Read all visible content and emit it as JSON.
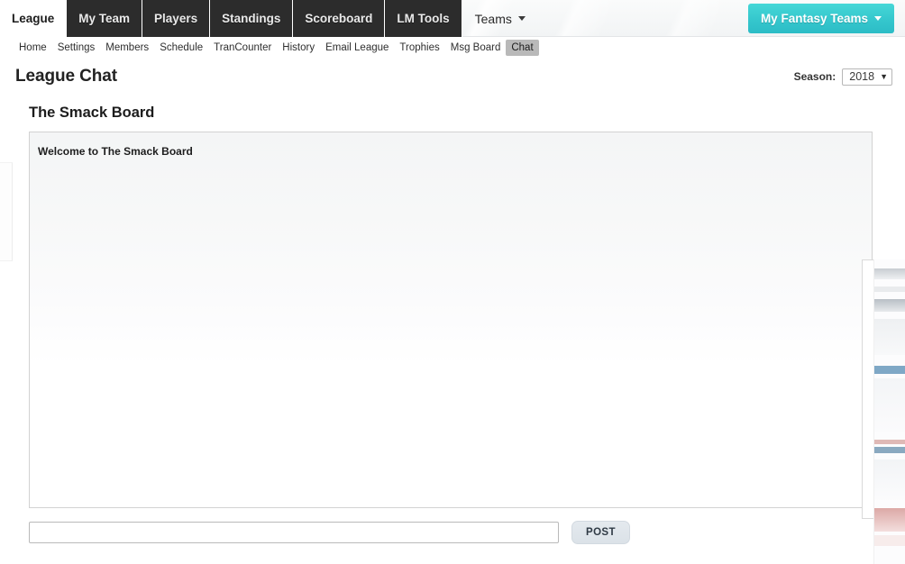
{
  "header": {
    "tabs": [
      {
        "label": "League",
        "active": true
      },
      {
        "label": "My Team",
        "active": false
      },
      {
        "label": "Players",
        "active": false
      },
      {
        "label": "Standings",
        "active": false
      },
      {
        "label": "Scoreboard",
        "active": false
      },
      {
        "label": "LM Tools",
        "active": false
      }
    ],
    "teams_menu_label": "Teams",
    "fantasy_teams_label": "My Fantasy Teams"
  },
  "subnav": {
    "items": [
      {
        "label": "Home",
        "active": false
      },
      {
        "label": "Settings",
        "active": false
      },
      {
        "label": "Members",
        "active": false
      },
      {
        "label": "Schedule",
        "active": false
      },
      {
        "label": "TranCounter",
        "active": false
      },
      {
        "label": "History",
        "active": false
      },
      {
        "label": "Email League",
        "active": false
      },
      {
        "label": "Trophies",
        "active": false
      },
      {
        "label": "Msg Board",
        "active": false
      },
      {
        "label": "Chat",
        "active": true
      }
    ]
  },
  "page": {
    "title": "League Chat",
    "season_label": "Season:",
    "season_value": "2018",
    "season_caret": "▼"
  },
  "board": {
    "heading": "The Smack Board",
    "welcome_message": "Welcome to The Smack Board",
    "messages": []
  },
  "post": {
    "input_value": "",
    "input_placeholder": "",
    "button_label": "POST"
  },
  "colors": {
    "accent_teal": "#35c7cd",
    "tab_dark": "#2c2c2c",
    "active_pill_gray": "#b9b9b9",
    "panel_border": "#d2d2d2",
    "post_button_bg": "#dfe5eb"
  }
}
